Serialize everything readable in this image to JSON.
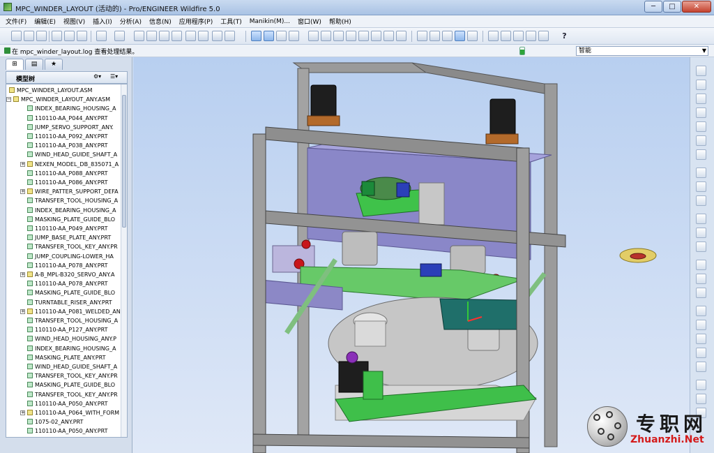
{
  "window": {
    "title": "MPC_WINDER_LAYOUT (活动的) - Pro/ENGINEER Wildfire 5.0",
    "minimize": "─",
    "maximize": "□",
    "close": "✕"
  },
  "menu": [
    "文件(F)",
    "编辑(E)",
    "视图(V)",
    "插入(I)",
    "分析(A)",
    "信息(N)",
    "应用程序(P)",
    "工具(T)",
    "Manikin(M)...",
    "窗口(W)",
    "帮助(H)"
  ],
  "toolbar": {
    "help_glyph": "?"
  },
  "message_bar": {
    "text": "在 mpc_winder_layout.log 查看处理结果。",
    "filter_value": "智能"
  },
  "navigator": {
    "tabs": [
      "model-tree",
      "folder-browser",
      "favorites"
    ],
    "header": "模型树",
    "tree": [
      {
        "label": "MPC_WINDER_LAYOUT.ASM",
        "type": "asm",
        "level": 0
      },
      {
        "label": "MPC_WINDER_LAYOUT_ANY.ASM",
        "type": "asm",
        "level": 1,
        "expander": "−"
      },
      {
        "label": "INDEX_BEARING_HOUSING_A",
        "type": "prt",
        "level": 2
      },
      {
        "label": "110110-AA_P044_ANY.PRT",
        "type": "prt",
        "level": 2
      },
      {
        "label": "JUMP_SERVO_SUPPORT_ANY.",
        "type": "prt",
        "level": 2
      },
      {
        "label": "110110-AA_P092_ANY.PRT",
        "type": "prt",
        "level": 2
      },
      {
        "label": "110110-AA_P038_ANY.PRT",
        "type": "prt",
        "level": 2
      },
      {
        "label": "WIND_HEAD_GUIDE_SHAFT_A",
        "type": "prt",
        "level": 2
      },
      {
        "label": "NEXEN_MODEL_DB_835071_A",
        "type": "asm",
        "level": 2,
        "expander": "+"
      },
      {
        "label": "110110-AA_P088_ANY.PRT",
        "type": "prt",
        "level": 2
      },
      {
        "label": "110110-AA_P086_ANY.PRT",
        "type": "prt",
        "level": 2
      },
      {
        "label": "WIRE_PATTER_SUPPORT_DEFA",
        "type": "asm",
        "level": 2,
        "expander": "+"
      },
      {
        "label": "TRANSFER_TOOL_HOUSING_A",
        "type": "prt",
        "level": 2
      },
      {
        "label": "INDEX_BEARING_HOUSING_A",
        "type": "prt",
        "level": 2
      },
      {
        "label": "MASKING_PLATE_GUIDE_BLO",
        "type": "prt",
        "level": 2
      },
      {
        "label": "110110-AA_P049_ANY.PRT",
        "type": "prt",
        "level": 2
      },
      {
        "label": "JUMP_BASE_PLATE_ANY.PRT",
        "type": "prt",
        "level": 2
      },
      {
        "label": "TRANSFER_TOOL_KEY_ANY.PR",
        "type": "prt",
        "level": 2
      },
      {
        "label": "JUMP_COUPLING-LOWER_HA",
        "type": "prt",
        "level": 2
      },
      {
        "label": "110110-AA_P078_ANY.PRT",
        "type": "prt",
        "level": 2
      },
      {
        "label": "A-B_MPL-B320_SERVO_ANY.A",
        "type": "asm",
        "level": 2,
        "expander": "+"
      },
      {
        "label": "110110-AA_P078_ANY.PRT",
        "type": "prt",
        "level": 2
      },
      {
        "label": "MASKING_PLATE_GUIDE_BLO",
        "type": "prt",
        "level": 2
      },
      {
        "label": "TURNTABLE_RISER_ANY.PRT",
        "type": "prt",
        "level": 2
      },
      {
        "label": "110110-AA_P081_WELDED_AN",
        "type": "asm",
        "level": 2,
        "expander": "+"
      },
      {
        "label": "TRANSFER_TOOL_HOUSING_A",
        "type": "prt",
        "level": 2
      },
      {
        "label": "110110-AA_P127_ANY.PRT",
        "type": "prt",
        "level": 2
      },
      {
        "label": "WIND_HEAD_HOUSING_ANY.P",
        "type": "prt",
        "level": 2
      },
      {
        "label": "INDEX_BEARING_HOUSING_A",
        "type": "prt",
        "level": 2
      },
      {
        "label": "MASKING_PLATE_ANY.PRT",
        "type": "prt",
        "level": 2
      },
      {
        "label": "WIND_HEAD_GUIDE_SHAFT_A",
        "type": "prt",
        "level": 2
      },
      {
        "label": "TRANSFER_TOOL_KEY_ANY.PR",
        "type": "prt",
        "level": 2
      },
      {
        "label": "MASKING_PLATE_GUIDE_BLO",
        "type": "prt",
        "level": 2
      },
      {
        "label": "TRANSFER_TOOL_KEY_ANY.PR",
        "type": "prt",
        "level": 2
      },
      {
        "label": "110110-AA_P050_ANY.PRT",
        "type": "prt",
        "level": 2
      },
      {
        "label": "110110-AA_P064_WITH_FORM",
        "type": "asm",
        "level": 2,
        "expander": "+"
      },
      {
        "label": "1075-02_ANY.PRT",
        "type": "prt",
        "level": 2
      },
      {
        "label": "110110-AA_P050_ANY.PRT",
        "type": "prt",
        "level": 2
      }
    ]
  },
  "watermark": {
    "cn": "专职网",
    "en": "Zhuanzhi.Net"
  },
  "colors": {
    "frame": "#8c8c8c",
    "plate_green": "#3fc24a",
    "housing_purple": "#8a87c8",
    "teal_part": "#1f6f6a",
    "background_top": "#b8cff0",
    "watermark_red": "#d41b1b"
  }
}
